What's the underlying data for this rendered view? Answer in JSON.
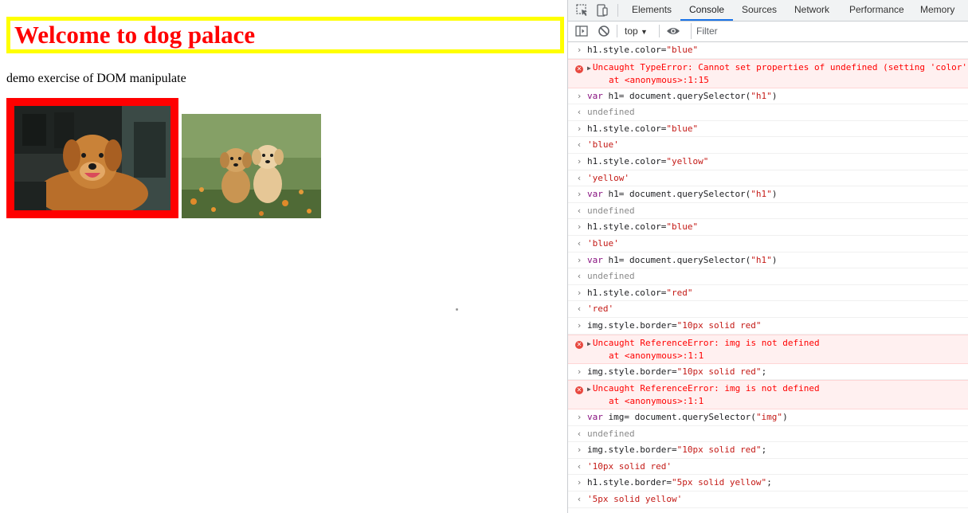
{
  "page": {
    "heading": "Welcome to dog palace",
    "paragraph": "demo exercise of DOM manipulate",
    "colors": {
      "heading_text": "#ff0000",
      "heading_border": "#ffff00",
      "image_border": "#ff0000"
    }
  },
  "devtools": {
    "tabs": [
      "Elements",
      "Console",
      "Sources",
      "Network",
      "Performance",
      "Memory"
    ],
    "active_tab": "Console",
    "context": "top",
    "filter_placeholder": "Filter",
    "accent": "#1a73e8",
    "lines": [
      {
        "type": "cmd",
        "text": "h1.style.color=\"blue\""
      },
      {
        "type": "err",
        "text": "Uncaught TypeError: Cannot set properties of undefined (setting 'color')",
        "at": "at <anonymous>:1:15"
      },
      {
        "type": "cmd",
        "text": "var h1= document.querySelector(\"h1\")"
      },
      {
        "type": "res",
        "text": "undefined"
      },
      {
        "type": "cmd",
        "text": "h1.style.color=\"blue\""
      },
      {
        "type": "str",
        "text": "'blue'"
      },
      {
        "type": "cmd",
        "text": "h1.style.color=\"yellow\""
      },
      {
        "type": "str",
        "text": "'yellow'"
      },
      {
        "type": "cmd",
        "text": "var h1= document.querySelector(\"h1\")"
      },
      {
        "type": "res",
        "text": "undefined"
      },
      {
        "type": "cmd",
        "text": "h1.style.color=\"blue\""
      },
      {
        "type": "str",
        "text": "'blue'"
      },
      {
        "type": "cmd",
        "text": "var h1= document.querySelector(\"h1\")"
      },
      {
        "type": "res",
        "text": "undefined"
      },
      {
        "type": "cmd",
        "text": "h1.style.color=\"red\""
      },
      {
        "type": "str",
        "text": "'red'"
      },
      {
        "type": "cmd",
        "text": "img.style.border=\"10px solid red\""
      },
      {
        "type": "err",
        "text": "Uncaught ReferenceError: img is not defined",
        "at": "at <anonymous>:1:1"
      },
      {
        "type": "cmd",
        "text": "img.style.border=\"10px solid red\";"
      },
      {
        "type": "err",
        "text": "Uncaught ReferenceError: img is not defined",
        "at": "at <anonymous>:1:1"
      },
      {
        "type": "cmd",
        "text": "var img= document.querySelector(\"img\")"
      },
      {
        "type": "res",
        "text": "undefined"
      },
      {
        "type": "cmd",
        "text": "img.style.border=\"10px solid red\";"
      },
      {
        "type": "str",
        "text": "'10px solid red'"
      },
      {
        "type": "cmd",
        "text": "h1.style.border=\"5px solid yellow\";"
      },
      {
        "type": "str",
        "text": "'5px solid yellow'"
      }
    ]
  }
}
